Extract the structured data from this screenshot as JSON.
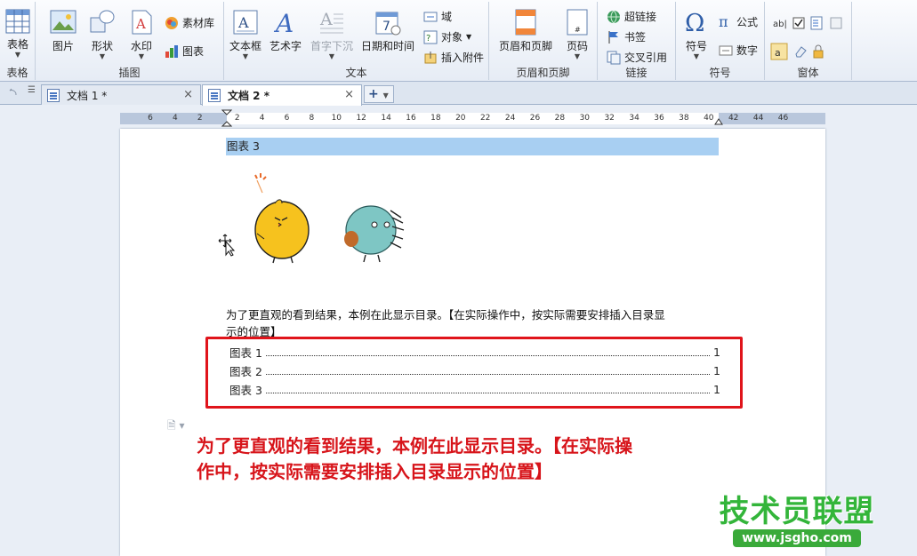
{
  "ribbon": {
    "groups": {
      "table": "表格",
      "illustrations": "插图",
      "text": "文本",
      "header_footer": "页眉和页脚",
      "links": "链接",
      "symbols": "符号",
      "form": "窗体"
    },
    "buttons": {
      "table": "表格",
      "picture": "图片",
      "shape": "形状",
      "watermark": "水印",
      "material_library": "素材库",
      "chart": "图表",
      "textbox": "文本框",
      "wordart": "艺术字",
      "drop_cap": "首字下沉",
      "date_time": "日期和时间",
      "field": "域",
      "object": "对象",
      "insert_attachment": "插入附件",
      "header_footer": "页眉和页脚",
      "page_number": "页码",
      "hyperlink": "超链接",
      "bookmark": "书签",
      "cross_reference": "交叉引用",
      "symbol": "符号",
      "formula": "公式",
      "number": "数字"
    }
  },
  "tabs": [
    {
      "label": "文档 1 *",
      "active": false
    },
    {
      "label": "文档 2 *",
      "active": true
    }
  ],
  "ruler_ticks": [
    "6",
    "4",
    "2",
    "2",
    "4",
    "6",
    "8",
    "10",
    "12",
    "14",
    "16",
    "18",
    "20",
    "22",
    "24",
    "26",
    "28",
    "30",
    "32",
    "34",
    "36",
    "38",
    "40",
    "42",
    "44",
    "46"
  ],
  "document": {
    "caption_highlight": "图表 3",
    "paragraph_line1": "为了更直观的看到结果，本例在此显示目录。【在实际操作中，按实际需要安排插入目录显",
    "paragraph_line2": "示的位置】",
    "toc": [
      {
        "label": "图表 1",
        "page": "1"
      },
      {
        "label": "图表 2",
        "page": "1"
      },
      {
        "label": "图表 3",
        "page": "1"
      }
    ],
    "note_line1": "为了更直观的看到结果，本例在此显示目录。【在实际操",
    "note_line2": "作中，按实际需要安排插入目录显示的位置】"
  },
  "watermark": {
    "title": "技术员联盟",
    "url": "www.jsgho.com"
  },
  "colors": {
    "highlight": "#a8cff2",
    "toc_border": "#e0141b",
    "note_text": "#d7141a",
    "watermark_green": "#33b53a"
  }
}
